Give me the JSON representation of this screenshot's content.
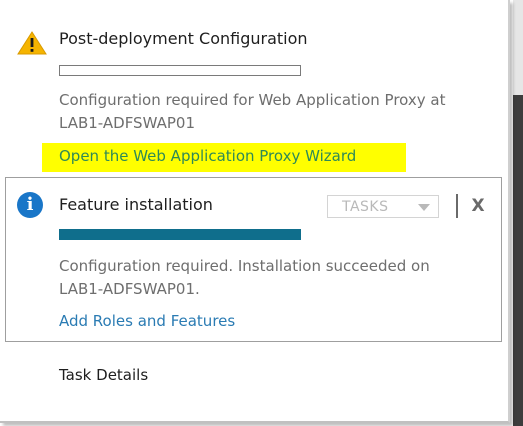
{
  "post_deployment": {
    "title": "Post-deployment Configuration",
    "progress": 0,
    "description_line1": "Configuration required for Web Application Proxy at",
    "description_line2": "LAB1-ADFSWAP01",
    "link": "Open the Web Application Proxy Wizard",
    "icon": "warning-icon",
    "highlight_color": "#ffff00"
  },
  "feature_installation": {
    "title": "Feature installation",
    "progress": 1,
    "tasks_label": "TASKS",
    "close_label": "X",
    "description_line1": "Configuration required. Installation succeeded on",
    "description_line2": "LAB1-ADFSWAP01.",
    "link": "Add Roles and Features",
    "icon": "info-icon",
    "progress_color": "#0f6e8c"
  },
  "footer": {
    "task_details": "Task Details"
  },
  "colors": {
    "warning": "#f5b400",
    "info": "#1976c8",
    "link": "#2a7bb3",
    "wizard_link": "#2f8a57"
  }
}
